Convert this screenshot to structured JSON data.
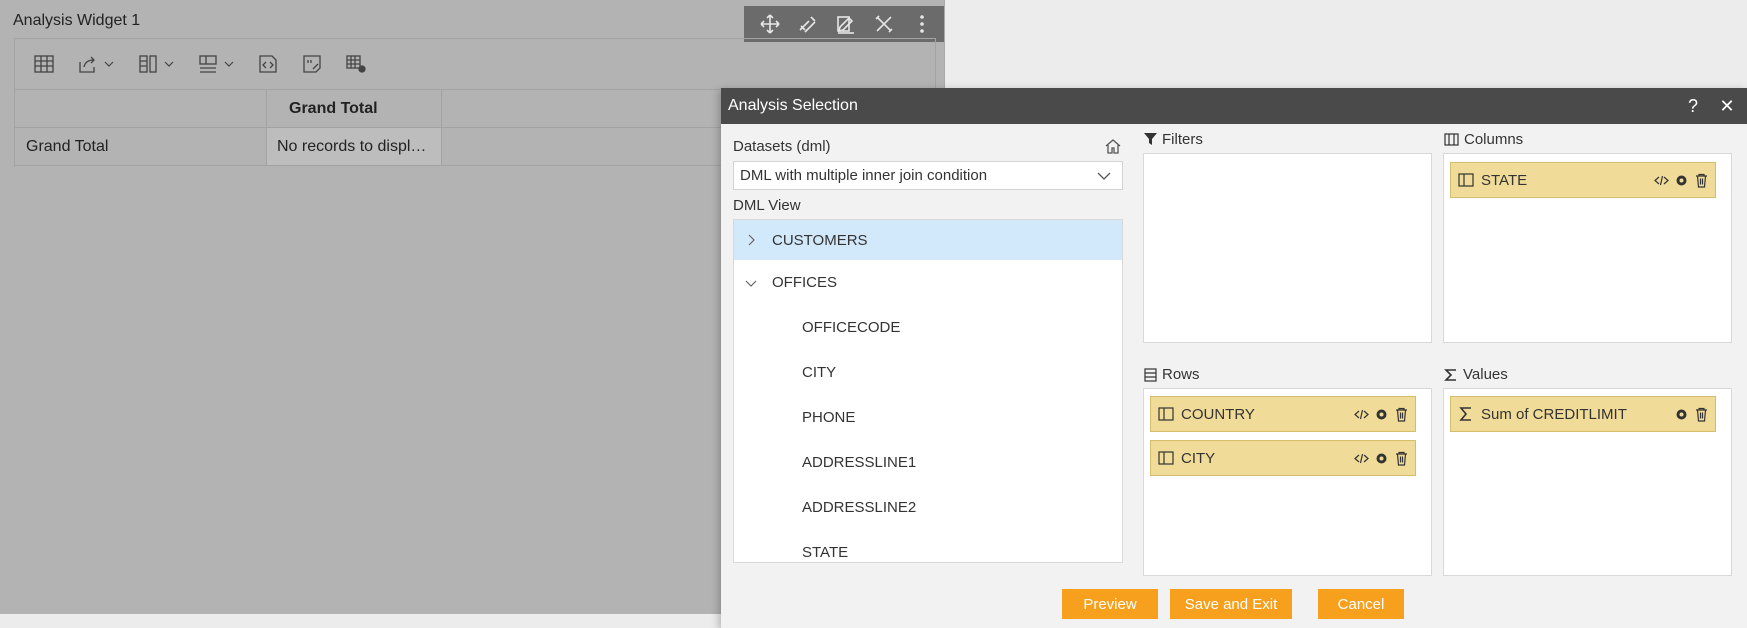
{
  "widget": {
    "title": "Analysis Widget 1",
    "table": {
      "header": [
        "",
        "Grand Total"
      ],
      "rows": [
        [
          "Grand Total",
          "No records to displ…"
        ]
      ]
    }
  },
  "modal": {
    "title": "Analysis Selection",
    "help_label": "?",
    "close_label": "✕",
    "datasets_label": "Datasets (dml)",
    "dataset_value": "DML with multiple inner join condition",
    "dml_view_label": "DML View",
    "tree": [
      {
        "label": "CUSTOMERS",
        "expanded": false,
        "child": false
      },
      {
        "label": "OFFICES",
        "expanded": true,
        "child": false
      },
      {
        "label": "OFFICECODE",
        "child": true
      },
      {
        "label": "CITY",
        "child": true
      },
      {
        "label": "PHONE",
        "child": true
      },
      {
        "label": "ADDRESSLINE1",
        "child": true
      },
      {
        "label": "ADDRESSLINE2",
        "child": true
      },
      {
        "label": "STATE",
        "child": true
      }
    ],
    "filters_label": "Filters",
    "columns_label": "Columns",
    "rows_label": "Rows",
    "values_label": "Values",
    "columns": [
      {
        "label": "STATE"
      }
    ],
    "rows": [
      {
        "label": "COUNTRY"
      },
      {
        "label": "CITY"
      }
    ],
    "values": [
      {
        "label": "Sum of CREDITLIMIT"
      }
    ],
    "buttons": {
      "preview": "Preview",
      "save_exit": "Save and Exit",
      "cancel": "Cancel"
    }
  },
  "colors": {
    "accent": "#f7a01e",
    "chip": "#f0dc98",
    "header": "#4a4a4a",
    "selected": "#d2e9fb"
  }
}
